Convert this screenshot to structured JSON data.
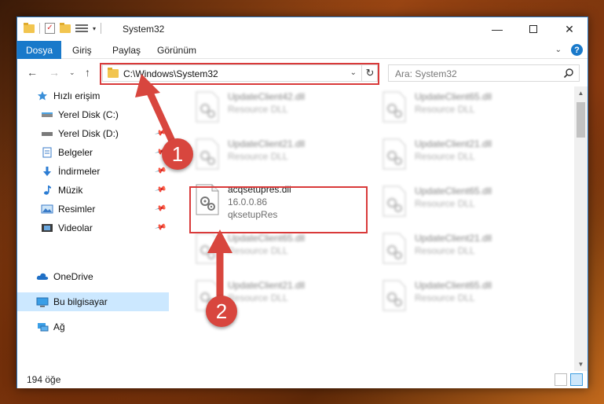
{
  "window": {
    "title": "System32",
    "minimize": "—",
    "close": "✕"
  },
  "ribbon": {
    "tabs": [
      "Dosya",
      "Giriş",
      "Paylaş",
      "Görünüm"
    ],
    "help": "?"
  },
  "address": {
    "path": "C:\\Windows\\System32",
    "search_placeholder": "Ara: System32"
  },
  "nav_pane": {
    "quick_access": "Hızlı erişim",
    "items": [
      {
        "label": "Yerel Disk (C:)",
        "icon": "drive-icon",
        "pinned": false
      },
      {
        "label": "Yerel Disk (D:)",
        "icon": "drive-icon",
        "pinned": true
      },
      {
        "label": "Belgeler",
        "icon": "documents-icon",
        "pinned": true
      },
      {
        "label": "İndirmeler",
        "icon": "download-icon",
        "pinned": true
      },
      {
        "label": "Müzik",
        "icon": "music-icon",
        "pinned": true
      },
      {
        "label": "Resimler",
        "icon": "pictures-icon",
        "pinned": true
      },
      {
        "label": "Videolar",
        "icon": "videos-icon",
        "pinned": true
      }
    ],
    "onedrive": "OneDrive",
    "this_pc": "Bu bilgisayar",
    "network": "Ağ"
  },
  "files": [
    {
      "name": "UpdateClient42.dll",
      "desc": [
        "Resource DLL"
      ]
    },
    {
      "name": "UpdateClient65.dll",
      "desc": [
        "Resource DLL"
      ]
    },
    {
      "name": "UpdateClient21.dll",
      "desc": [
        "Resource DLL"
      ]
    },
    {
      "name": "UpdateClient21.dll",
      "desc": [
        "Resource DLL"
      ]
    },
    {
      "name": "acqsetupres.dll",
      "desc": [
        "16.0.0.86",
        "qksetupRes"
      ]
    },
    {
      "name": "UpdateClient65.dll",
      "desc": [
        "Resource DLL"
      ]
    },
    {
      "name": "UpdateClient65.dll",
      "desc": [
        "Resource DLL"
      ]
    },
    {
      "name": "UpdateClient21.dll",
      "desc": [
        "Resource DLL"
      ]
    },
    {
      "name": "UpdateClient21.dll",
      "desc": [
        "Resource DLL"
      ]
    },
    {
      "name": "UpdateClient65.dll",
      "desc": [
        "Resource DLL"
      ]
    }
  ],
  "status": {
    "count": "194 öğe"
  },
  "annotations": {
    "step1": "1",
    "step2": "2",
    "color": "#d8463e"
  }
}
